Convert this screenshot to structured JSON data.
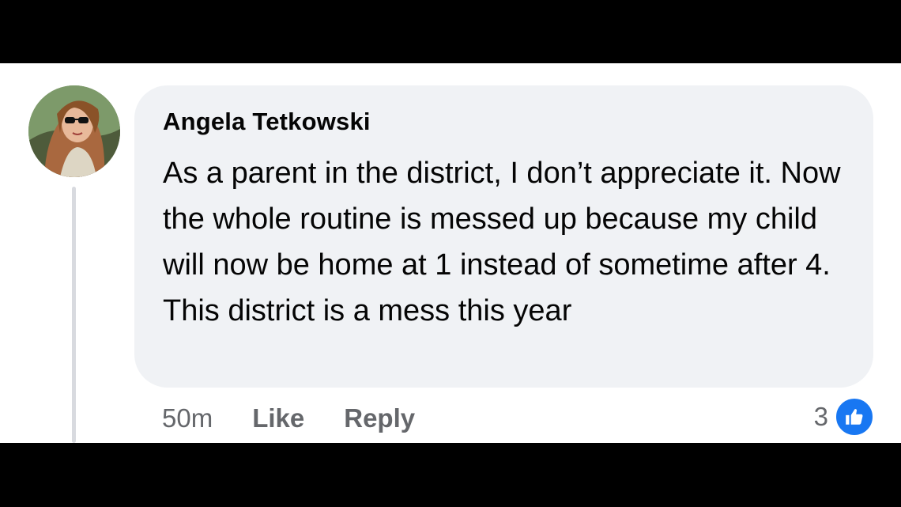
{
  "comment": {
    "author": "Angela Tetkowski",
    "text": "As a parent in the district, I don’t appreciate it. Now the whole routine is messed up because my child will now be home at 1 instead of sometime after 4. This district is a mess this year",
    "timestamp": "50m",
    "like_label": "Like",
    "reply_label": "Reply",
    "reaction_count": "3",
    "reaction_icon": "thumbs-up-icon"
  },
  "colors": {
    "bubble": "#f0f2f5",
    "text": "#050505",
    "meta": "#65676b",
    "like_blue": "#1877f2"
  }
}
